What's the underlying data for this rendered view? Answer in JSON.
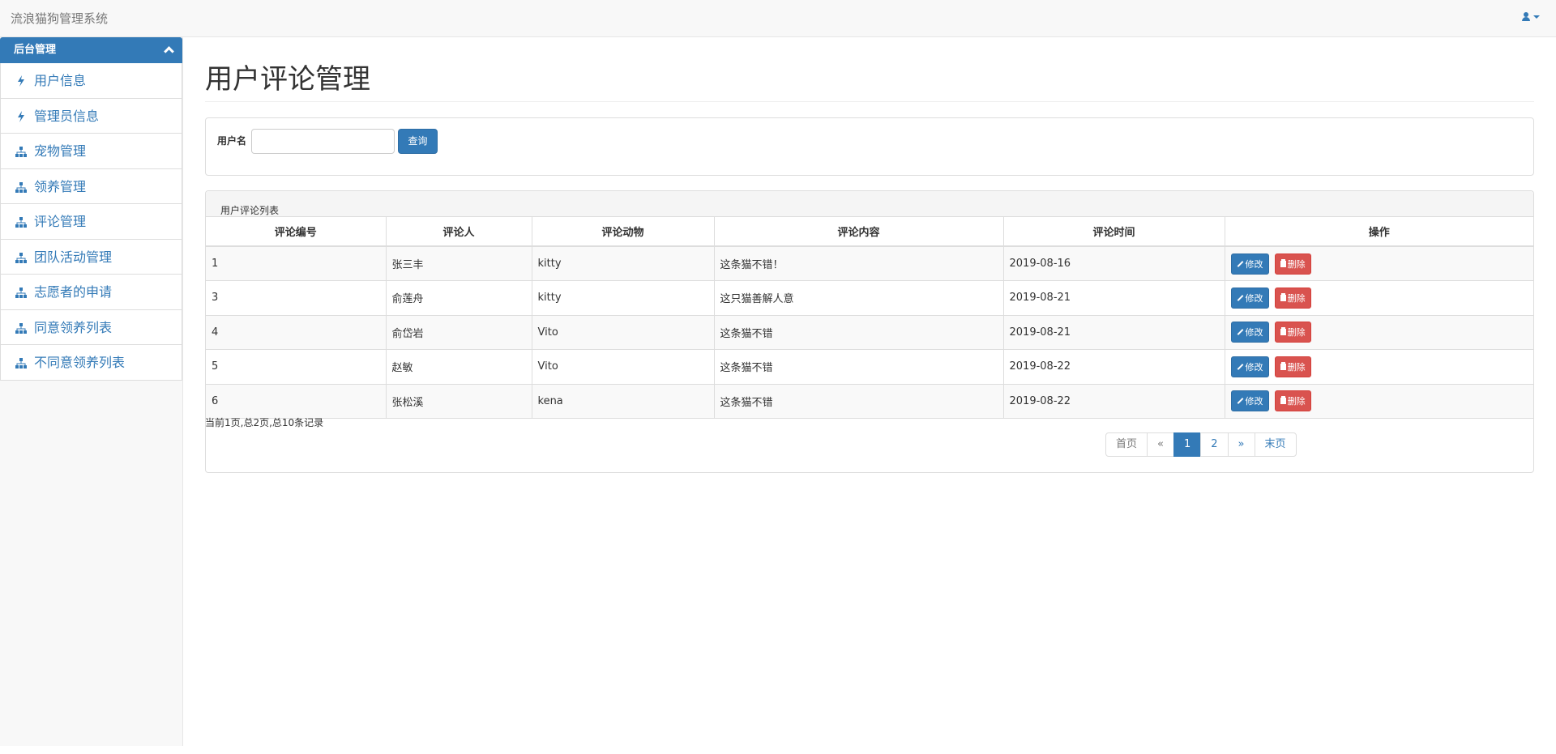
{
  "app": {
    "title": "流浪猫狗管理系统"
  },
  "sidebar": {
    "panel_title": "后台管理",
    "items": [
      {
        "label": "用户信息",
        "icon": "bolt-icon"
      },
      {
        "label": "管理员信息",
        "icon": "bolt-icon"
      },
      {
        "label": "宠物管理",
        "icon": "sitemap-icon"
      },
      {
        "label": "领养管理",
        "icon": "sitemap-icon"
      },
      {
        "label": "评论管理",
        "icon": "sitemap-icon"
      },
      {
        "label": "团队活动管理",
        "icon": "sitemap-icon"
      },
      {
        "label": "志愿者的申请",
        "icon": "sitemap-icon"
      },
      {
        "label": "同意领养列表",
        "icon": "sitemap-icon"
      },
      {
        "label": "不同意领养列表",
        "icon": "sitemap-icon"
      }
    ]
  },
  "main": {
    "page_title": "用户评论管理",
    "search": {
      "label": "用户名",
      "value": "",
      "placeholder": "",
      "button": "查询"
    },
    "list_caption": "用户评论列表",
    "columns": [
      "评论编号",
      "评论人",
      "评论动物",
      "评论内容",
      "评论时间",
      "操作"
    ],
    "rows": [
      {
        "id": "1",
        "user": "张三丰",
        "animal": "kitty",
        "content": "这条猫不错！",
        "time": "2019-08-16"
      },
      {
        "id": "3",
        "user": "俞莲舟",
        "animal": "kitty",
        "content": "这只猫善解人意",
        "time": "2019-08-21"
      },
      {
        "id": "4",
        "user": "俞岱岩",
        "animal": "Vito",
        "content": "这条猫不错",
        "time": "2019-08-21"
      },
      {
        "id": "5",
        "user": "赵敏",
        "animal": "Vito",
        "content": "这条猫不错",
        "time": "2019-08-22"
      },
      {
        "id": "6",
        "user": "张松溪",
        "animal": "kena",
        "content": "这条猫不错",
        "time": "2019-08-22"
      }
    ],
    "actions": {
      "edit": "修改",
      "delete": "删除"
    },
    "record_info": "当前1页,总2页,总10条记录",
    "pager": {
      "first": "首页",
      "prev": "«",
      "pages": [
        "1",
        "2"
      ],
      "current": "1",
      "next": "»",
      "last": "末页"
    }
  },
  "colors": {
    "primary": "#337ab7",
    "danger": "#d9534f",
    "navbar": "#f8f8f8"
  }
}
